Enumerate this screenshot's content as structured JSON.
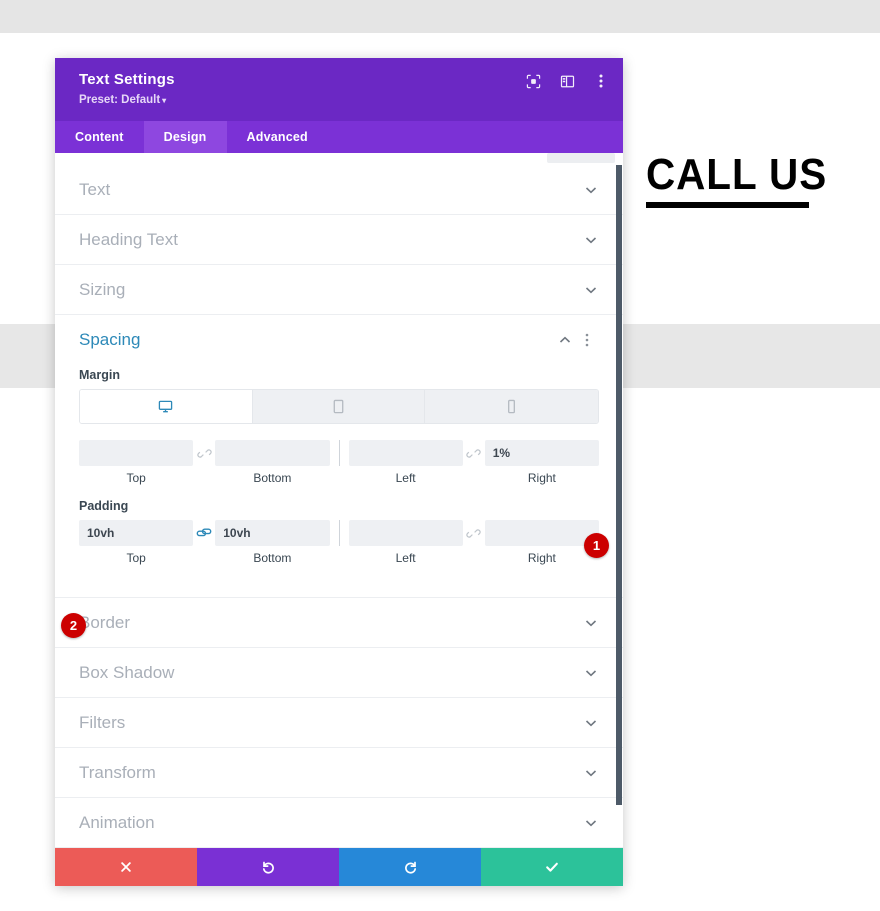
{
  "page": {
    "background_text": "CALL US",
    "band_color": "#e5e5e5"
  },
  "modal": {
    "title": "Text Settings",
    "preset_label": "Preset: Default",
    "preset_caret": "▾",
    "header_icons": [
      {
        "name": "focus-icon",
        "label": "focus"
      },
      {
        "name": "layout-icon",
        "label": "layout"
      },
      {
        "name": "more-options-icon",
        "label": "more"
      }
    ],
    "tabs": [
      {
        "label": "Content",
        "active": false
      },
      {
        "label": "Design",
        "active": true
      },
      {
        "label": "Advanced",
        "active": false
      }
    ],
    "sections": [
      {
        "label": "Text",
        "open": false
      },
      {
        "label": "Heading Text",
        "open": false
      },
      {
        "label": "Sizing",
        "open": false
      },
      {
        "label": "Spacing",
        "open": true
      },
      {
        "label": "Border",
        "open": false
      },
      {
        "label": "Box Shadow",
        "open": false
      },
      {
        "label": "Filters",
        "open": false
      },
      {
        "label": "Transform",
        "open": false
      },
      {
        "label": "Animation",
        "open": false
      }
    ],
    "spacing": {
      "title": "Spacing",
      "device_tabs": [
        {
          "name": "desktop",
          "active": true
        },
        {
          "name": "tablet",
          "active": false
        },
        {
          "name": "phone",
          "active": false
        }
      ],
      "margin": {
        "label": "Margin",
        "top": {
          "value": "",
          "caption": "Top"
        },
        "bottom": {
          "value": "",
          "caption": "Bottom"
        },
        "left": {
          "value": "",
          "caption": "Left"
        },
        "right": {
          "value": "1%",
          "caption": "Right"
        },
        "link_top_bottom": "unlinked",
        "link_left_right": "unlinked"
      },
      "padding": {
        "label": "Padding",
        "top": {
          "value": "10vh",
          "caption": "Top"
        },
        "bottom": {
          "value": "10vh",
          "caption": "Bottom"
        },
        "left": {
          "value": "",
          "caption": "Left"
        },
        "right": {
          "value": "",
          "caption": "Right"
        },
        "link_top_bottom": "linked",
        "link_left_right": "unlinked"
      }
    },
    "annotations": [
      {
        "number": "1",
        "color": "#cc0000"
      },
      {
        "number": "2",
        "color": "#cc0000"
      }
    ],
    "footer_buttons": [
      {
        "name": "cancel-button",
        "icon": "close-icon",
        "color": "#ec5b57"
      },
      {
        "name": "undo-button",
        "icon": "undo-icon",
        "color": "#7a30d4"
      },
      {
        "name": "redo-button",
        "icon": "redo-icon",
        "color": "#2688d8"
      },
      {
        "name": "save-button",
        "icon": "check-icon",
        "color": "#2cc29a"
      }
    ]
  }
}
